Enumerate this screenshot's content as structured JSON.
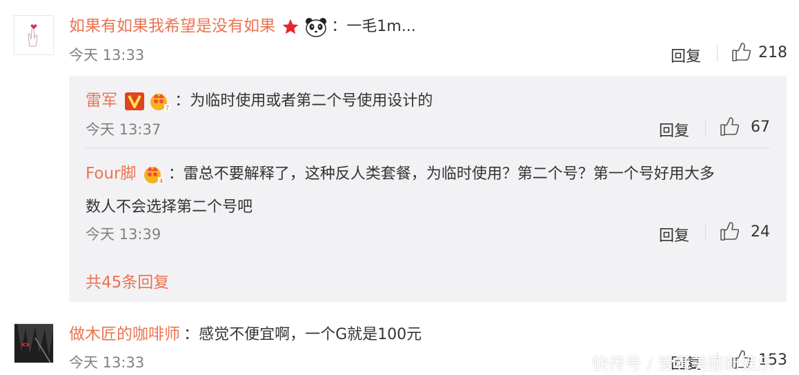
{
  "comments": [
    {
      "username": "如果有如果我希望是没有如果",
      "text": "：一毛1m...",
      "time": "今天 13:33",
      "reply_label": "回复",
      "likes": "218",
      "replies": [
        {
          "username": "雷军",
          "text": "：为临时使用或者第二个号使用设计的",
          "time": "今天 13:37",
          "reply_label": "回复",
          "likes": "67"
        },
        {
          "username": "Four脚",
          "text_line1": "：雷总不要解释了，这种反人类套餐，为临时使用？第二个号？第一个号好用大多",
          "text_line2": "数人不会选择第二个号吧",
          "time": "今天 13:39",
          "reply_label": "回复",
          "likes": "24"
        }
      ],
      "more_replies": "共45条回复"
    },
    {
      "username": "做木匠的咖啡师",
      "text": "：感觉不便宜啊，一个G就是100元",
      "time": "今天 13:33",
      "reply_label": "回复",
      "likes": "153"
    }
  ],
  "watermark": "快传号 / 爱看美丽新娱乐",
  "colors": {
    "username": "#eb7350",
    "reply_bg": "#f2f2f5",
    "time": "#808080"
  }
}
